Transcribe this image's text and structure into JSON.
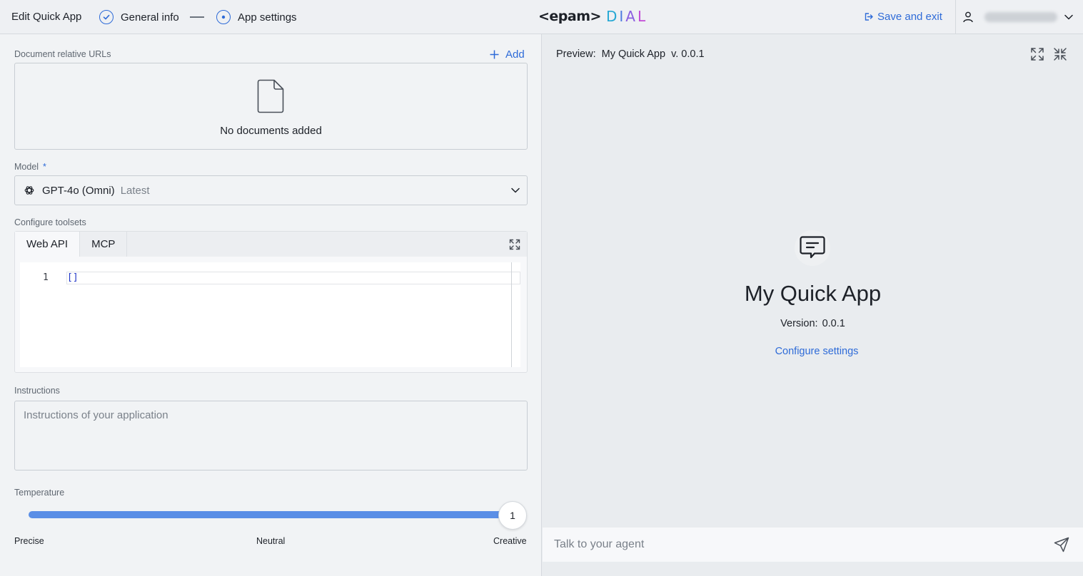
{
  "header": {
    "title": "Edit Quick App",
    "steps": [
      {
        "label": "General info",
        "state": "completed"
      },
      {
        "label": "App settings",
        "state": "current"
      }
    ],
    "logo": {
      "brand": "<epam>",
      "product": "DIAL"
    },
    "save_exit_label": "Save and exit",
    "user_icon": "user-icon"
  },
  "left": {
    "documents": {
      "label": "Document relative URLs",
      "add_label": "Add",
      "empty_text": "No documents added"
    },
    "model": {
      "label": "Model",
      "required_mark": "*",
      "name": "GPT-4o (Omni)",
      "version": "Latest"
    },
    "toolsets": {
      "label": "Configure toolsets",
      "tabs": [
        "Web API",
        "MCP"
      ],
      "active_tab": "Web API",
      "editor": {
        "line_numbers": [
          "1"
        ],
        "code": "[]"
      }
    },
    "instructions": {
      "label": "Instructions",
      "placeholder": "Instructions of your application",
      "value": ""
    },
    "temperature": {
      "label": "Temperature",
      "value": "1",
      "fill_fraction": 1.0,
      "marks": [
        "Precise",
        "Neutral",
        "Creative"
      ]
    }
  },
  "preview": {
    "prefix": "Preview:",
    "app_name": "My Quick App",
    "version_tag": "v. 0.0.1",
    "agent_name": "My Quick App",
    "version_label": "Version:",
    "version_value": "0.0.1",
    "configure_link": "Configure settings",
    "chat_placeholder": "Talk to your agent"
  },
  "colors": {
    "accent": "#2e6bd8",
    "slider": "#5a8ee6",
    "dial_gradient": [
      "#26a8d4",
      "#4f7ce0",
      "#8a5ee0",
      "#c24bd6"
    ]
  }
}
